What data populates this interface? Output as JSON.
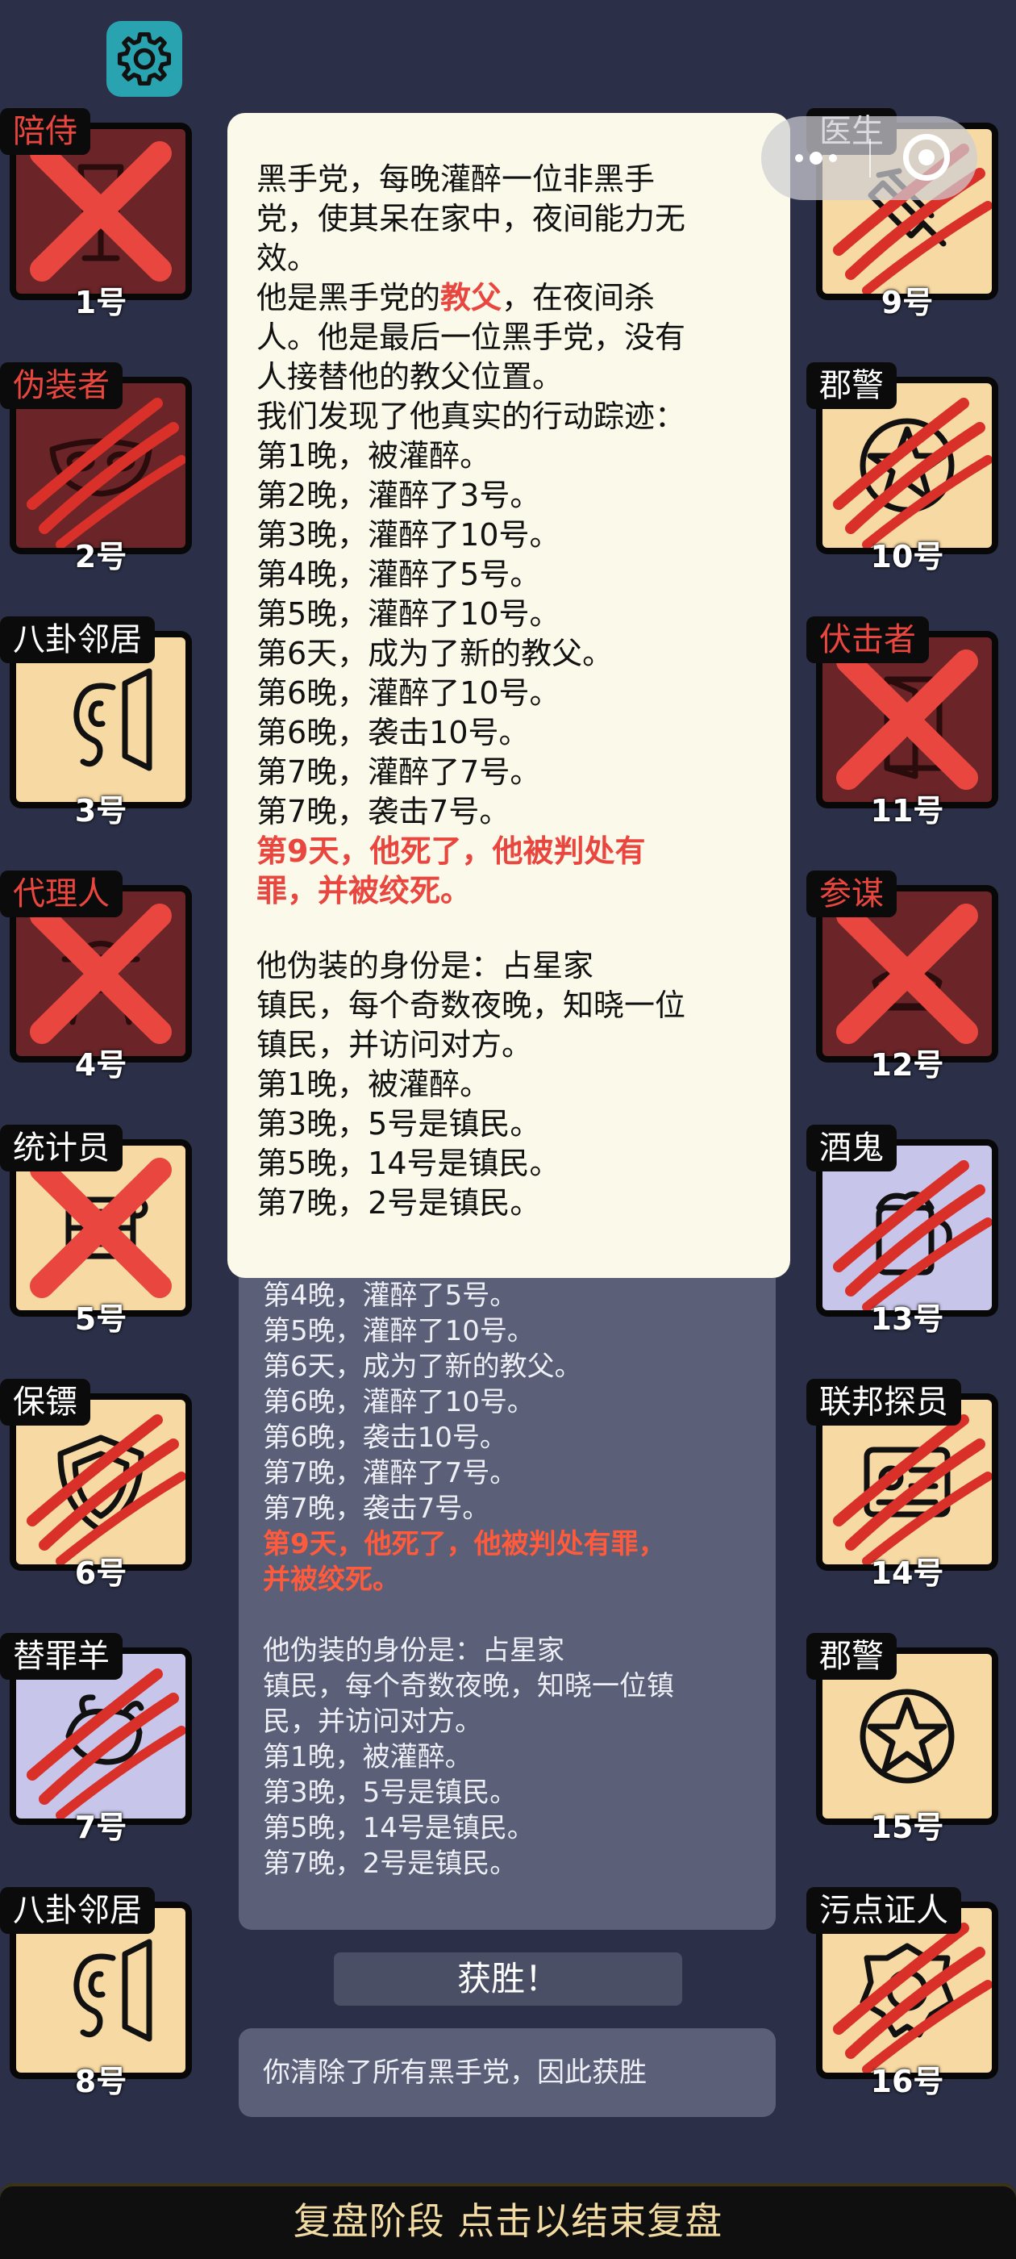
{
  "settings_icon": "gear-icon",
  "players": [
    {
      "num": "1号",
      "role": "陪侍",
      "state": "dead",
      "mark": "x",
      "icon": "wine-glass"
    },
    {
      "num": "2号",
      "role": "伪装者",
      "state": "dead",
      "mark": "claw",
      "icon": "mask"
    },
    {
      "num": "3号",
      "role": "八卦邻居",
      "state": "alive",
      "mark": "none",
      "icon": "ear"
    },
    {
      "num": "4号",
      "role": "代理人",
      "state": "dead",
      "mark": "x",
      "icon": "agent"
    },
    {
      "num": "5号",
      "role": "统计员",
      "state": "alive",
      "mark": "x",
      "icon": "scroll"
    },
    {
      "num": "6号",
      "role": "保镖",
      "state": "alive",
      "mark": "claw",
      "icon": "shield"
    },
    {
      "num": "7号",
      "role": "替罪羊",
      "state": "drunk",
      "mark": "claw",
      "icon": "goat"
    },
    {
      "num": "8号",
      "role": "八卦邻居",
      "state": "alive",
      "mark": "none",
      "icon": "ear"
    },
    {
      "num": "9号",
      "role": "医生",
      "state": "alive",
      "mark": "claw",
      "icon": "syringe"
    },
    {
      "num": "10号",
      "role": "郡警",
      "state": "alive",
      "mark": "claw",
      "icon": "star-badge"
    },
    {
      "num": "11号",
      "role": "伏击者",
      "state": "dead",
      "mark": "x",
      "icon": "door"
    },
    {
      "num": "12号",
      "role": "参谋",
      "state": "dead",
      "mark": "x",
      "icon": "hat"
    },
    {
      "num": "13号",
      "role": "酒鬼",
      "state": "drunk",
      "mark": "claw",
      "icon": "beer"
    },
    {
      "num": "14号",
      "role": "联邦探员",
      "state": "alive",
      "mark": "claw",
      "icon": "id-card"
    },
    {
      "num": "15号",
      "role": "郡警",
      "state": "alive",
      "mark": "none",
      "icon": "star-badge"
    },
    {
      "num": "16号",
      "role": "污点证人",
      "state": "alive",
      "mark": "claw",
      "icon": "badge"
    }
  ],
  "popup": {
    "lines": [
      {
        "t": "黑手党，每晚灌醉一位非黑手"
      },
      {
        "t": "党，使其呆在家中，夜间能力无"
      },
      {
        "t": "效。"
      },
      {
        "pre": "他是黑手党的",
        "em": "教父",
        "post": "，在夜间杀"
      },
      {
        "t": "人。他是最后一位黑手党，没有"
      },
      {
        "t": "人接替他的教父位置。"
      },
      {
        "t": "我们发现了他真实的行动踪迹："
      },
      {
        "t": "第1晚，被灌醉。"
      },
      {
        "t": "第2晚，灌醉了3号。"
      },
      {
        "t": "第3晚，灌醉了10号。"
      },
      {
        "t": "第4晚，灌醉了5号。"
      },
      {
        "t": "第5晚，灌醉了10号。"
      },
      {
        "t": "第6天，成为了新的教父。"
      },
      {
        "t": "第6晚，灌醉了10号。"
      },
      {
        "t": "第6晚，袭击10号。"
      },
      {
        "t": "第7晚，灌醉了7号。"
      },
      {
        "t": "第7晚，袭击7号。"
      },
      {
        "hl": "第9天，他死了，他被判处有"
      },
      {
        "hl": "罪，并被绞死。"
      },
      {
        "blank": true
      },
      {
        "t": "他伪装的身份是：占星家"
      },
      {
        "t": "镇民，每个奇数夜晚，知晓一位"
      },
      {
        "t": "镇民，并访问对方。"
      },
      {
        "t": "第1晚，被灌醉。"
      },
      {
        "t": "第3晚，5号是镇民。"
      },
      {
        "t": "第5晚，14号是镇民。"
      },
      {
        "t": "第7晚，2号是镇民。"
      }
    ]
  },
  "background_log": {
    "lines": [
      {
        "t": "第3晚，灌醉了10号。"
      },
      {
        "t": "第4晚，灌醉了5号。"
      },
      {
        "t": "第5晚，灌醉了10号。"
      },
      {
        "t": "第6天，成为了新的教父。"
      },
      {
        "t": "第6晚，灌醉了10号。"
      },
      {
        "t": "第6晚，袭击10号。"
      },
      {
        "t": "第7晚，灌醉了7号。"
      },
      {
        "t": "第7晚，袭击7号。"
      },
      {
        "hl": "第9天，他死了，他被判处有罪，"
      },
      {
        "hl": "并被绞死。"
      },
      {
        "blank": true
      },
      {
        "t": "他伪装的身份是：占星家"
      },
      {
        "t": "镇民，每个奇数夜晚，知晓一位镇"
      },
      {
        "t": "民，并访问对方。"
      },
      {
        "t": "第1晚，被灌醉。"
      },
      {
        "t": "第3晚，5号是镇民。"
      },
      {
        "t": "第5晚，14号是镇民。"
      },
      {
        "t": "第7晚，2号是镇民。"
      }
    ]
  },
  "result": {
    "title": "获胜！",
    "description": "你清除了所有黑手党，因此获胜"
  },
  "bottom_bar": "复盘阶段 点击以结束复盘",
  "colors": {
    "background": "#2b3048",
    "alive": "#f7d9a3",
    "dead": "#6b2427",
    "drunk": "#c7c6ea",
    "mark_red": "#e8463e",
    "popup_bg": "#fbf9ea",
    "gear_bg": "#2aa3b1"
  }
}
